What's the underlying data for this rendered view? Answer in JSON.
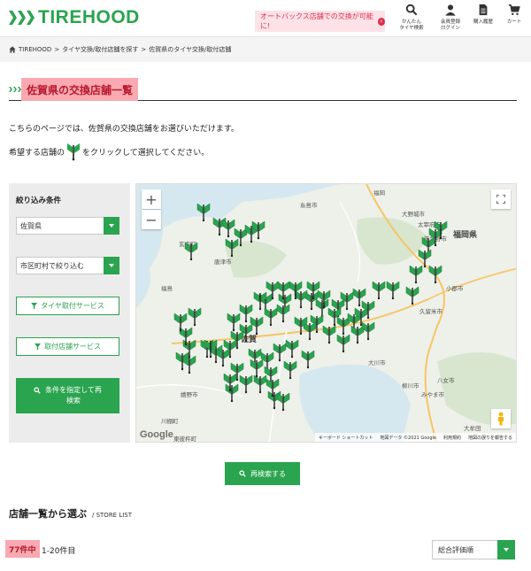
{
  "header": {
    "logo_text": "TIREHOOD",
    "promo_text": "オートバックス店舗での交換が可能に!",
    "nav": [
      {
        "label": "かんたん\nタイヤ検索",
        "icon": "search-icon"
      },
      {
        "label": "会員登録\nログイン",
        "icon": "user-icon"
      },
      {
        "label": "購入履歴",
        "icon": "document-icon"
      },
      {
        "label": "カート",
        "icon": "cart-icon"
      }
    ]
  },
  "breadcrumb": [
    "TIREHOOD",
    ">",
    "タイヤ交換/取付店舗を探す",
    ">",
    "佐賀県のタイヤ交換/取付店舗"
  ],
  "page": {
    "title": "佐賀県の交換店舗一覧",
    "intro_line1": "こちらのページでは、佐賀県の交換店舗をお選びいただけます。",
    "intro_line2_prefix": "希望する店舗の",
    "intro_line2_suffix": "をクリックして選択してください。"
  },
  "filter": {
    "title": "絞り込み条件",
    "prefecture_value": "佐賀県",
    "city_value": "市区町村で絞り込む",
    "tire_service_label": "タイヤ取付サービス",
    "shop_service_label": "取付店舗サービス",
    "search_button_label": "条件を指定して再\n検索"
  },
  "map": {
    "zoom_in": "+",
    "zoom_out": "−",
    "google_label": "Google",
    "footer": [
      "キーボード ショートカット",
      "地図データ ©2021 Google",
      "利用規約",
      "地図の誤りを報告する"
    ],
    "labels": [
      {
        "text": "福岡",
        "cls": ""
      },
      {
        "text": "糸島市",
        "cls": ""
      },
      {
        "text": "大野城市",
        "cls": ""
      },
      {
        "text": "太宰府市",
        "cls": ""
      },
      {
        "text": "筑紫野市",
        "cls": ""
      },
      {
        "text": "福岡県",
        "cls": "big"
      },
      {
        "text": "玄海町",
        "cls": ""
      },
      {
        "text": "唐津市",
        "cls": ""
      },
      {
        "text": "福島",
        "cls": ""
      },
      {
        "text": "小郡市",
        "cls": ""
      },
      {
        "text": "久留米市",
        "cls": ""
      },
      {
        "text": "佐賀",
        "cls": "big"
      },
      {
        "text": "大川市",
        "cls": ""
      },
      {
        "text": "柳川市",
        "cls": ""
      },
      {
        "text": "八女市",
        "cls": ""
      },
      {
        "text": "みやま市",
        "cls": ""
      },
      {
        "text": "嬉野市",
        "cls": ""
      },
      {
        "text": "川棚町",
        "cls": ""
      },
      {
        "text": "東彼杵町",
        "cls": ""
      },
      {
        "text": "大牟田",
        "cls": ""
      }
    ],
    "pin_color": "#2aa44f"
  },
  "research_label": "再検索する",
  "store_list": {
    "title": "店舗一覧から選ぶ",
    "subtitle": "/ STORE LIST",
    "count": "77件中",
    "range": "1-20件目",
    "sort_value": "総合評価順"
  },
  "colors": {
    "brand_green": "#2aa44f",
    "accent_pink": "#f9a9b1",
    "accent_red": "#b8182d"
  }
}
